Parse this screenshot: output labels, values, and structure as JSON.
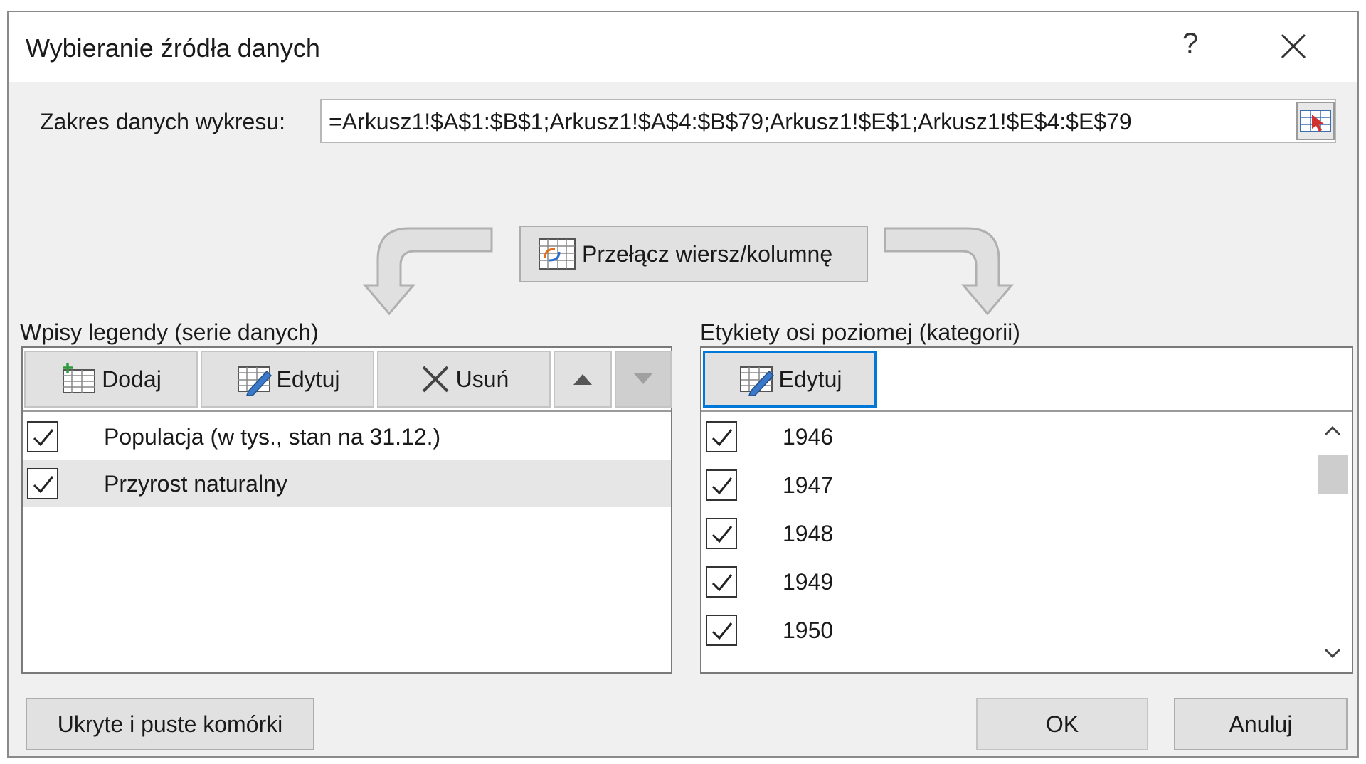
{
  "dialog": {
    "title": "Wybieranie źródła danych",
    "help_label": "?",
    "close_icon": "close-icon"
  },
  "range": {
    "label": "Zakres danych wykresu:",
    "value": "=Arkusz1!$A$1:$B$1;Arkusz1!$A$4:$B$79;Arkusz1!$E$1;Arkusz1!$E$4:$E$79",
    "collapse_icon": "range-select-icon"
  },
  "switch_button": {
    "label": "Przełącz wiersz/kolumnę",
    "icon": "switch-row-column-icon"
  },
  "legend": {
    "heading": "Wpisy legendy (serie danych)",
    "buttons": {
      "add": "Dodaj",
      "edit": "Edytuj",
      "remove": "Usuń"
    },
    "series": [
      {
        "label": "Populacja (w tys., stan na 31.12.)",
        "checked": true,
        "selected": false
      },
      {
        "label": "Przyrost naturalny",
        "checked": true,
        "selected": true
      }
    ]
  },
  "categories": {
    "heading": "Etykiety osi poziomej (kategorii)",
    "edit_label": "Edytuj",
    "items": [
      "1946",
      "1947",
      "1948",
      "1949",
      "1950"
    ]
  },
  "footer": {
    "hidden_cells": "Ukryte i puste komórki",
    "ok": "OK",
    "cancel": "Anuluj"
  },
  "colors": {
    "accent": "#0078d7",
    "dialog_bg": "#f0f0f0",
    "button_bg": "#e1e1e1"
  }
}
